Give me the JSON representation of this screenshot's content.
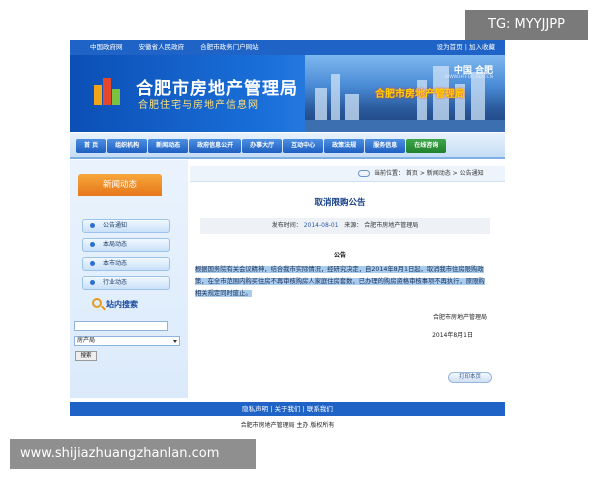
{
  "topbar": {
    "left_links": [
      "中国政府网",
      "安徽省人民政府",
      "合肥市政务门户网站"
    ],
    "right_links": "设为首页 | 加入收藏"
  },
  "banner": {
    "title": "合肥市房地产管理局",
    "subtitle": "合肥住宅与房地产信息网",
    "brand": "中国 合肥",
    "url": "WWW.HFFDC.GOV.CN",
    "neon_sign": "合肥市房地产管理局"
  },
  "nav": {
    "items": [
      "首 页",
      "组织机构",
      "新闻动态",
      "政府信息公开",
      "办事大厅",
      "互动中心",
      "政策法规",
      "服务信息",
      "在线咨询"
    ]
  },
  "sidebar": {
    "header": "新闻动态",
    "menu": [
      "公告通知",
      "本局动态",
      "本市动态",
      "行业动态"
    ],
    "search_title": "站内搜索",
    "search_select": "房产局",
    "search_button": "搜索"
  },
  "breadcrumb": "当前位置： 首页 > 新闻动态 > 公告通知",
  "article": {
    "title": "取消限购公告",
    "meta_label_time": "发布时间：",
    "meta_time": "2014-08-01",
    "meta_label_source": "来源：",
    "meta_source": "合肥市房地产管理局",
    "notice_head": "公告",
    "body": "根据国务院有关会议精神，结合我市实际情况，经研究决定，自2014年8月1日起，取消我市住房限购政策，在全市范围内购买住房不再审核购房人家庭住房套数，已办理的购房资格审核事项不再执行，原限购相关规定同时废止。",
    "signature": "合肥市房地产管理局",
    "date": "2014年8月1日",
    "print_button": "打印本页"
  },
  "footer": {
    "links": "隐私声明 | 关于我们 | 联系我们",
    "info": "合肥市房地产管理局 主办 版权所有"
  },
  "watermarks": {
    "tg": "TG: MYYJJPP",
    "site": "www.shijiazhuangzhanlan.com"
  },
  "colors": {
    "primary_blue": "#1f63c6",
    "orange": "#e6761b",
    "highlight": "#a8ccf0"
  }
}
